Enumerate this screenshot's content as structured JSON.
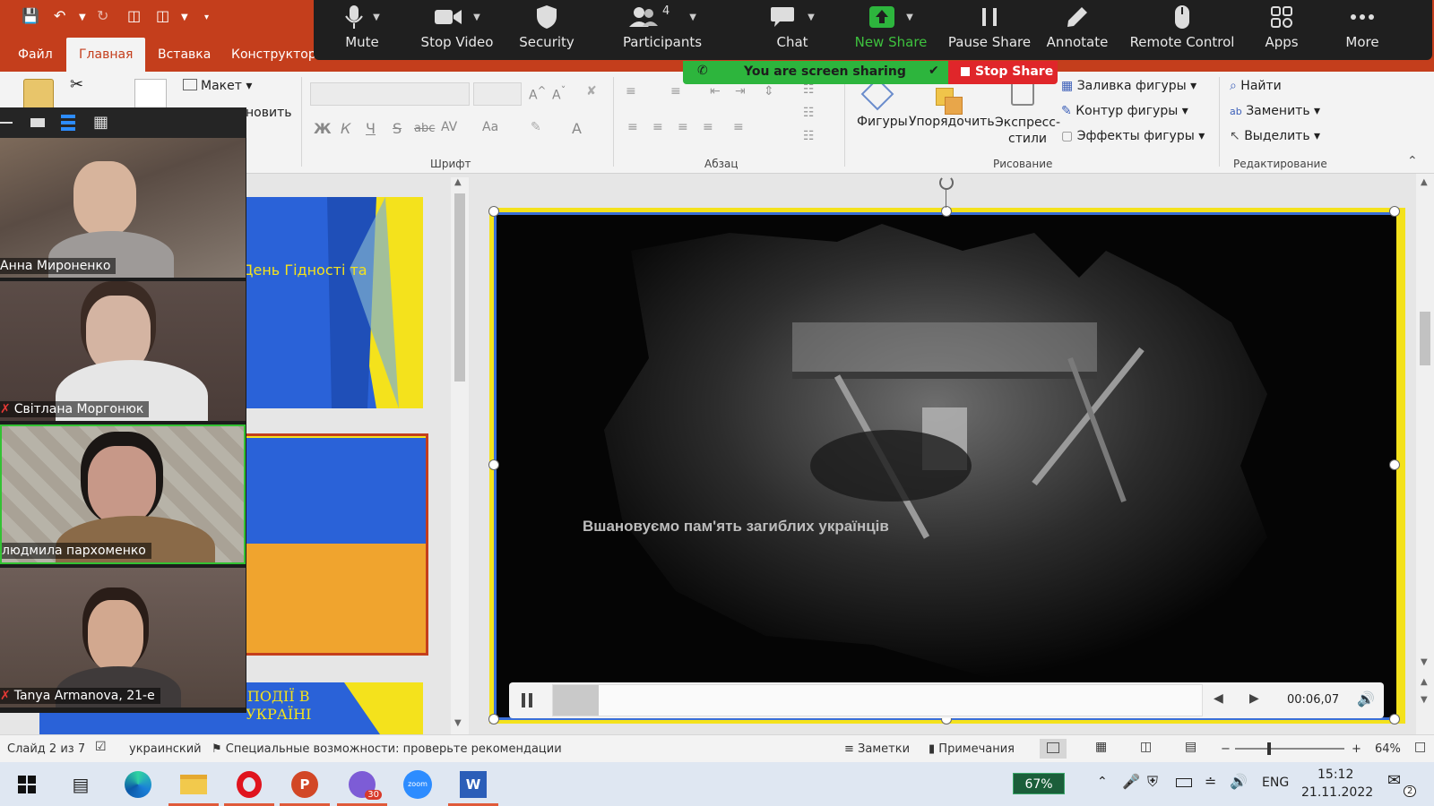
{
  "ribbon": {
    "tabs": [
      "Файл",
      "Главная",
      "Вставка",
      "Конструктор"
    ],
    "active_tab": "Главная",
    "clipboard": {
      "layout_label": "Макет",
      "reset_label": "новить"
    },
    "font": {
      "group_label": "Шрифт",
      "bold": "Ж",
      "italic": "К",
      "underline": "Ч",
      "strike": "S",
      "abc": "abc",
      "av": "AV",
      "aa": "Aa",
      "A": "A"
    },
    "paragraph": {
      "group_label": "Абзац"
    },
    "drawing": {
      "group_label": "Рисование",
      "shapes_label": "Фигуры",
      "arrange_label": "Упорядочить",
      "styles_label": "Экспресс-\nстили",
      "fill_label": "Заливка фигуры",
      "outline_label": "Контур фигуры",
      "effects_label": "Эффекты фигуры"
    },
    "editing": {
      "group_label": "Редактирование",
      "find_label": "Найти",
      "replace_label": "Заменить",
      "select_label": "Выделить"
    }
  },
  "zoom": {
    "buttons": [
      {
        "label": "Mute",
        "icon": "microphone-icon"
      },
      {
        "label": "Stop Video",
        "icon": "video-camera-icon"
      },
      {
        "label": "Security",
        "icon": "shield-icon"
      },
      {
        "label": "Participants",
        "icon": "participants-icon",
        "count": "4"
      },
      {
        "label": "Chat",
        "icon": "chat-bubble-icon"
      },
      {
        "label": "New Share",
        "icon": "share-up-arrow-icon"
      },
      {
        "label": "Pause Share",
        "icon": "pause-icon"
      },
      {
        "label": "Annotate",
        "icon": "pencil-icon"
      },
      {
        "label": "Remote Control",
        "icon": "mouse-icon"
      },
      {
        "label": "Apps",
        "icon": "apps-icon"
      },
      {
        "label": "More",
        "icon": "ellipsis-icon"
      }
    ],
    "sharing_banner": "You are screen sharing",
    "stop_share": "Stop Share"
  },
  "participants": [
    {
      "name": "Анна Мироненко",
      "muted": false
    },
    {
      "name": "Світлана Моргонюк",
      "muted": true
    },
    {
      "name": "людмила пархоменко",
      "muted": false
    },
    {
      "name": "Tanya Armanova, 21-е",
      "muted": true
    }
  ],
  "slides": [
    {
      "title": "День Гідності та"
    },
    {
      "title": ""
    },
    {
      "title": "ПОДІЇ В\nУКРАЇНІ"
    }
  ],
  "video": {
    "caption": "Вшановуємо пам'ять загиблих українців",
    "time": "00:06,07",
    "progress": 0.07
  },
  "status_bar": {
    "slide": "Слайд 2 из 7",
    "language": "украинский",
    "accessibility": "Специальные возможности: проверьте рекомендации",
    "notes": "Заметки",
    "comments": "Примечания",
    "zoom_minus": "−",
    "zoom_plus": "+",
    "zoom": "64%"
  },
  "taskbar": {
    "battery": "67%",
    "lang": "ENG",
    "time": "15:12",
    "date": "21.11.2022",
    "viber_badge": "30",
    "notif_badge": "2",
    "zoom_app": "zoom",
    "word_app": "W"
  },
  "colors": {
    "ppt_red": "#c43e1c",
    "zoom_dark": "#1f1f1f",
    "share_green": "#2db53d",
    "stop_red": "#e0262a",
    "ua_blue": "#2a62d8",
    "ua_yellow": "#f4e21c"
  }
}
